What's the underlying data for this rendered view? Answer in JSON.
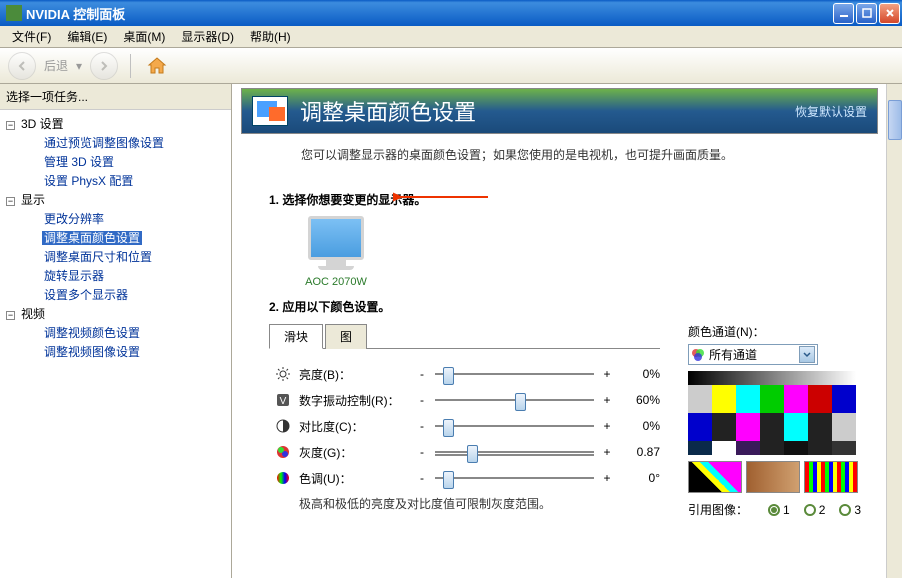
{
  "window": {
    "title": "NVIDIA 控制面板"
  },
  "menu": {
    "file": "文件(F)",
    "edit": "编辑(E)",
    "desktop": "桌面(M)",
    "display": "显示器(D)",
    "help": "帮助(H)"
  },
  "toolbar": {
    "back": "后退"
  },
  "sidebar": {
    "header": "选择一项任务...",
    "groups": [
      {
        "label": "3D 设置",
        "items": [
          "通过预览调整图像设置",
          "管理 3D 设置",
          "设置 PhysX 配置"
        ]
      },
      {
        "label": "显示",
        "items": [
          "更改分辨率",
          "调整桌面颜色设置",
          "调整桌面尺寸和位置",
          "旋转显示器",
          "设置多个显示器"
        ],
        "selected": 1
      },
      {
        "label": "视频",
        "items": [
          "调整视频颜色设置",
          "调整视频图像设置"
        ]
      }
    ]
  },
  "page": {
    "title": "调整桌面颜色设置",
    "restore": "恢复默认设置",
    "description": "您可以调整显示器的桌面颜色设置；如果您使用的是电视机，也可提升画面质量。",
    "step1": "1. 选择你想要变更的显示器。",
    "step2": "2. 应用以下颜色设置。",
    "monitor": "AOC 2070W",
    "tabs": {
      "slider": "滑块",
      "chart": "图"
    },
    "sliders": {
      "brightness": {
        "label": "亮度(B)：",
        "value": "0%",
        "pos": 5
      },
      "vibrance": {
        "label": "数字振动控制(R)：",
        "value": "60%",
        "pos": 50
      },
      "contrast": {
        "label": "对比度(C)：",
        "value": "0%",
        "pos": 5
      },
      "gamma": {
        "label": "灰度(G)：",
        "value": "0.87",
        "pos": 20
      },
      "hue": {
        "label": "色调(U)：",
        "value": "0°",
        "pos": 5
      }
    },
    "note": "极高和极低的亮度及对比度值可限制灰度范围。",
    "channel": {
      "label": "颜色通道(N)：",
      "selected": "所有通道"
    },
    "refimage": {
      "label": "引用图像：",
      "options": [
        "1",
        "2",
        "3"
      ]
    }
  }
}
